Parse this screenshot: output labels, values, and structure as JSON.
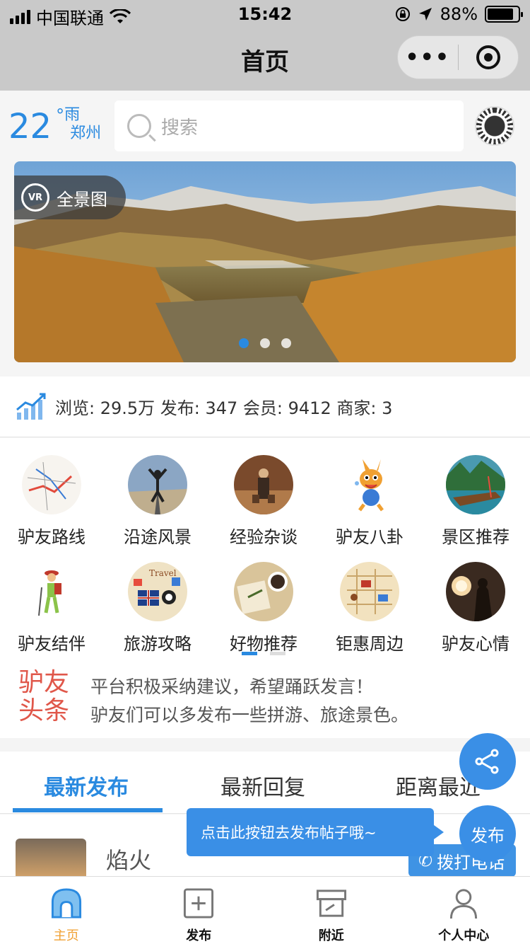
{
  "status_bar": {
    "carrier": "中国联通",
    "time": "15:42",
    "battery": "88%"
  },
  "nav": {
    "title": "首页"
  },
  "weather": {
    "temperature": "22",
    "degree": "°",
    "condition": "雨",
    "city": "郑州"
  },
  "search": {
    "placeholder": "搜索"
  },
  "banner": {
    "vr_label": "全景图",
    "vr_icon_text": "VR",
    "slide_count": 3,
    "active_slide": 1
  },
  "stats": {
    "text": "浏览: 29.5万 发布: 347 会员: 9412 商家: 3"
  },
  "categories": [
    {
      "label": "驴友路线",
      "icon": "route-map-icon"
    },
    {
      "label": "沿途风景",
      "icon": "scenery-icon"
    },
    {
      "label": "经验杂谈",
      "icon": "experience-icon"
    },
    {
      "label": "驴友八卦",
      "icon": "kangaroo-icon"
    },
    {
      "label": "景区推荐",
      "icon": "scenic-icon"
    },
    {
      "label": "驴友结伴",
      "icon": "hiker-icon"
    },
    {
      "label": "旅游攻略",
      "icon": "travel-guide-icon"
    },
    {
      "label": "好物推荐",
      "icon": "goods-icon"
    },
    {
      "label": "钜惠周边",
      "icon": "deals-icon"
    },
    {
      "label": "驴友心情",
      "icon": "mood-icon"
    }
  ],
  "headline": {
    "tag_line1": "驴友",
    "tag_line2": "头条",
    "line1": "平台积极采纳建议，希望踊跃发言！",
    "line2": "驴友们可以多发布一些拼游、旅途景色。"
  },
  "tabs": [
    {
      "label": "最新发布",
      "active": true
    },
    {
      "label": "最新回复",
      "active": false
    },
    {
      "label": "距离最近",
      "active": false
    }
  ],
  "post": {
    "title": "焰火",
    "call_label": "拨打电话"
  },
  "tooltip": {
    "text": "点击此按钮去发布帖子哦~"
  },
  "fab": {
    "publish_label": "发布"
  },
  "tabbar": [
    {
      "label": "主页",
      "active": true
    },
    {
      "label": "发布",
      "active": false
    },
    {
      "label": "附近",
      "active": false
    },
    {
      "label": "个人中心",
      "active": false
    }
  ],
  "colors": {
    "accent": "#2a8ae0",
    "headline_red": "#e0574a",
    "tab_active": "#f0a032"
  }
}
